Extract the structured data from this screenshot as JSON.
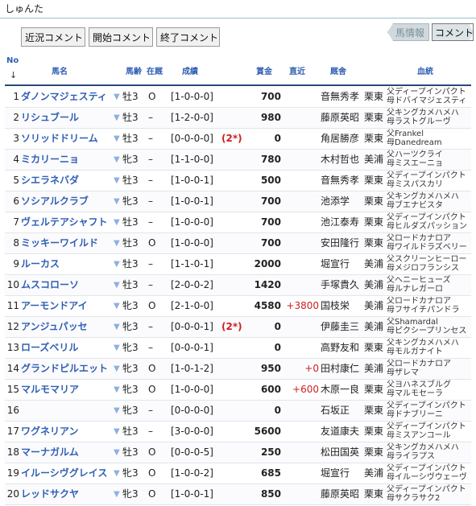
{
  "header": {
    "title": "しゅんた"
  },
  "buttons": {
    "recent": "近況コメント",
    "start": "開始コメント",
    "end": "終了コメント"
  },
  "tabs": {
    "horse": "馬情報",
    "comment": "コメント"
  },
  "columns": {
    "no": "No",
    "sort": "↓",
    "name": "馬名",
    "age": "馬齢",
    "zai": "在厩",
    "results": "成績",
    "prize": "賞金",
    "recent": "直近",
    "trainer": "厩舎",
    "bloodline": "血統"
  },
  "rows": [
    {
      "no": "1",
      "name": "ダノンマジェスティ",
      "age": "牡3",
      "zai": "O",
      "results": "[1-0-0-0]",
      "note": "",
      "prize": "700",
      "recent": "",
      "trainer": "音無秀孝",
      "loc": "栗東",
      "sire": "父ディープインパクト",
      "dam": "母ドバイマジェスティ"
    },
    {
      "no": "2",
      "name": "リシュブール",
      "age": "牡3",
      "zai": "–",
      "results": "[1-2-0-0]",
      "note": "",
      "prize": "980",
      "recent": "",
      "trainer": "藤原英昭",
      "loc": "栗東",
      "sire": "父キングカメハメハ",
      "dam": "母ラストグルーヴ"
    },
    {
      "no": "3",
      "name": "ソリッドドリーム",
      "age": "牡3",
      "zai": "–",
      "results": "[0-0-0-0]",
      "note": "(2*)",
      "prize": "0",
      "recent": "",
      "trainer": "角居勝彦",
      "loc": "栗東",
      "sire": "父Frankel",
      "dam": "母Danedream"
    },
    {
      "no": "4",
      "name": "ミカリーニョ",
      "age": "牝3",
      "zai": "–",
      "results": "[1-1-0-0]",
      "note": "",
      "prize": "780",
      "recent": "",
      "trainer": "木村哲也",
      "loc": "美浦",
      "sire": "父ハーツクライ",
      "dam": "母ミスエーニョ"
    },
    {
      "no": "5",
      "name": "シエラネバダ",
      "age": "牡3",
      "zai": "–",
      "results": "[1-0-0-1]",
      "note": "",
      "prize": "500",
      "recent": "",
      "trainer": "音無秀孝",
      "loc": "栗東",
      "sire": "父ディープインパクト",
      "dam": "母ミスパスカリ"
    },
    {
      "no": "6",
      "name": "ソシアルクラブ",
      "age": "牝3",
      "zai": "–",
      "results": "[1-0-0-1]",
      "note": "",
      "prize": "700",
      "recent": "",
      "trainer": "池添学",
      "loc": "栗東",
      "sire": "父キングカメハメハ",
      "dam": "母ブエナビスタ"
    },
    {
      "no": "7",
      "name": "ヴェルテアシャフト",
      "age": "牡3",
      "zai": "–",
      "results": "[1-0-0-0]",
      "note": "",
      "prize": "700",
      "recent": "",
      "trainer": "池江泰寿",
      "loc": "栗東",
      "sire": "父ディープインパクト",
      "dam": "母ヒルダズパッション"
    },
    {
      "no": "8",
      "name": "ミッキーワイルド",
      "age": "牡3",
      "zai": "O",
      "results": "[1-0-0-0]",
      "note": "",
      "prize": "700",
      "recent": "",
      "trainer": "安田隆行",
      "loc": "栗東",
      "sire": "父ロードカナロア",
      "dam": "母ワイルドラズベリー"
    },
    {
      "no": "9",
      "name": "ルーカス",
      "age": "牡3",
      "zai": "–",
      "results": "[1-1-0-1]",
      "note": "",
      "prize": "2000",
      "recent": "",
      "trainer": "堀宣行",
      "loc": "美浦",
      "sire": "父スクリーンヒーロー",
      "dam": "母メジロフランシス"
    },
    {
      "no": "10",
      "name": "ムスコローソ",
      "age": "牡3",
      "zai": "–",
      "results": "[2-0-0-2]",
      "note": "",
      "prize": "1420",
      "recent": "",
      "trainer": "手塚貴久",
      "loc": "美浦",
      "sire": "父ヘニーヒューズ",
      "dam": "母ルナレガーロ"
    },
    {
      "no": "11",
      "name": "アーモンドアイ",
      "age": "牝3",
      "zai": "O",
      "results": "[2-1-0-0]",
      "note": "",
      "prize": "4580",
      "recent": "+3800",
      "trainer": "国枝栄",
      "loc": "美浦",
      "sire": "父ロードカナロア",
      "dam": "母フサイチパンドラ"
    },
    {
      "no": "12",
      "name": "アンジュパッセ",
      "age": "牝3",
      "zai": "–",
      "results": "[0-0-0-1]",
      "note": "(2*)",
      "prize": "0",
      "recent": "",
      "trainer": "伊藤圭三",
      "loc": "美浦",
      "sire": "父Shamardal",
      "dam": "母ピクシープリンセス"
    },
    {
      "no": "13",
      "name": "ローズベリル",
      "age": "牝3",
      "zai": "–",
      "results": "[0-0-0-1]",
      "note": "",
      "prize": "0",
      "recent": "",
      "trainer": "高野友和",
      "loc": "栗東",
      "sire": "父キングカメハメハ",
      "dam": "母モルガナイト"
    },
    {
      "no": "14",
      "name": "グランドピルエット",
      "age": "牝3",
      "zai": "O",
      "results": "[1-0-1-2]",
      "note": "",
      "prize": "950",
      "recent": "+0",
      "trainer": "田村康仁",
      "loc": "美浦",
      "sire": "父ロードカナロア",
      "dam": "母ザレマ"
    },
    {
      "no": "15",
      "name": "マルモマリア",
      "age": "牝3",
      "zai": "O",
      "results": "[1-0-0-0]",
      "note": "",
      "prize": "600",
      "recent": "+600",
      "trainer": "木原一良",
      "loc": "栗東",
      "sire": "父ヨハネスブルグ",
      "dam": "母マルモセーラ"
    },
    {
      "no": "16",
      "name": "",
      "age": "牝3",
      "zai": "–",
      "results": "[0-0-0-0]",
      "note": "",
      "prize": "0",
      "recent": "",
      "trainer": "石坂正",
      "loc": "栗東",
      "sire": "父ディープインパクト",
      "dam": "母ドナブリーニ"
    },
    {
      "no": "17",
      "name": "ワグネリアン",
      "age": "牡3",
      "zai": "–",
      "results": "[3-0-0-0]",
      "note": "",
      "prize": "5600",
      "recent": "",
      "trainer": "友道康夫",
      "loc": "栗東",
      "sire": "父ディープインパクト",
      "dam": "母ミスアンコール"
    },
    {
      "no": "18",
      "name": "マーナガルム",
      "age": "牡3",
      "zai": "O",
      "results": "[0-0-0-5]",
      "note": "",
      "prize": "250",
      "recent": "",
      "trainer": "松田国英",
      "loc": "栗東",
      "sire": "父キングカメハメハ",
      "dam": "母ライラプス"
    },
    {
      "no": "19",
      "name": "イルーシヴグレイス",
      "age": "牝3",
      "zai": "O",
      "results": "[1-0-0-2]",
      "note": "",
      "prize": "685",
      "recent": "",
      "trainer": "堀宣行",
      "loc": "美浦",
      "sire": "父ディープインパクト",
      "dam": "母イルーシヴウェーヴ"
    },
    {
      "no": "20",
      "name": "レッドサクヤ",
      "age": "牝3",
      "zai": "O",
      "results": "[1-0-0-1]",
      "note": "",
      "prize": "850",
      "recent": "",
      "trainer": "藤原英昭",
      "loc": "栗東",
      "sire": "父ディープインパクト",
      "dam": "母サクラサク2"
    }
  ]
}
